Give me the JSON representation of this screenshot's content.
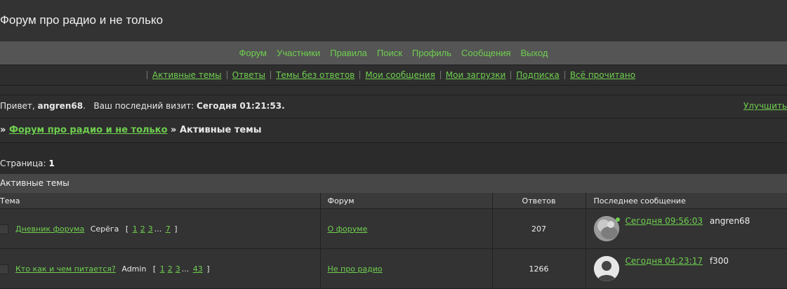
{
  "header": {
    "title": "Форум про радио и не только"
  },
  "mainnav": [
    "Форум",
    "Участники",
    "Правила",
    "Поиск",
    "Профиль",
    "Сообщения",
    "Выход"
  ],
  "subnav": [
    "Активные темы",
    "Ответы",
    "Темы без ответов",
    "Мои сообщения",
    "Мои загрузки",
    "Подписка",
    "Всё прочитано"
  ],
  "welcome": {
    "greeting": "Привет,",
    "username": "angren68",
    "last_visit_label": "Ваш последний визит:",
    "last_visit_value": "Сегодня 01:21:53",
    "improve_link": "Улучшить"
  },
  "breadcrumb": {
    "sep": "»",
    "forum": "Форум про радио и не только",
    "current": "Активные темы"
  },
  "pagination": {
    "label": "Страница:",
    "current": "1"
  },
  "table": {
    "title": "Активные темы",
    "columns": [
      "Тема",
      "Форум",
      "Ответов",
      "Последнее сообщение"
    ],
    "rows": [
      {
        "topic": "Дневник форума",
        "author": "Серёга",
        "pages": [
          "1",
          "2",
          "3",
          "...",
          "7"
        ],
        "forum": "О форуме",
        "replies": "207",
        "last_time": "Сегодня 09:56:03",
        "last_user": "angren68",
        "avatar": "photo-avatar"
      },
      {
        "topic": "Кто как и чем питается?",
        "author": "Admin",
        "pages": [
          "1",
          "2",
          "3",
          "...",
          "43"
        ],
        "forum": "Не про радио",
        "replies": "1266",
        "last_time": "Сегодня 04:23:17",
        "last_user": "f300",
        "avatar": "default-user-avatar"
      }
    ]
  }
}
